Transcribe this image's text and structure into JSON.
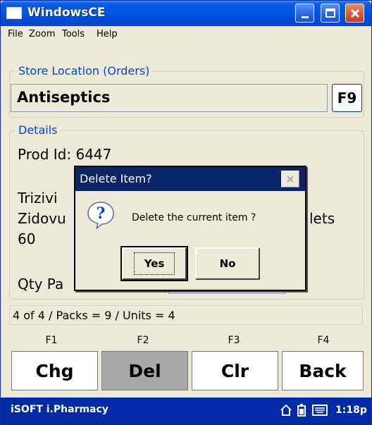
{
  "window": {
    "title": "WindowsCE"
  },
  "menu": [
    "File",
    "Zoom",
    "Tools",
    "Help"
  ],
  "store_location": {
    "legend": "Store Location (Orders)",
    "value": "Antiseptics",
    "f9_label": "F9"
  },
  "details": {
    "legend": "Details",
    "prod_id": "Prod Id: 6447",
    "line1": "Trizivi",
    "line2": "Zidovu",
    "line2_tail": "lets",
    "line3": "60",
    "qty_label": "Qty Pa"
  },
  "status": "4 of 4 / Packs = 9 / Units = 4",
  "fkeys": [
    {
      "key": "F1",
      "label": "Chg"
    },
    {
      "key": "F2",
      "label": "Del"
    },
    {
      "key": "F3",
      "label": "Clr"
    },
    {
      "key": "F4",
      "label": "Back"
    }
  ],
  "dialog": {
    "title": "Delete Item?",
    "close_glyph": "✕",
    "message": "Delete the current item ?",
    "yes": "Yes",
    "no": "No"
  },
  "taskbar": {
    "app": "iSOFT i.Pharmacy",
    "time": "1:18p"
  },
  "colors": {
    "titlebar": "#0454e0",
    "taskbar": "#002aa6",
    "legend": "#0046d5",
    "dialog_title": "#0a246a"
  }
}
